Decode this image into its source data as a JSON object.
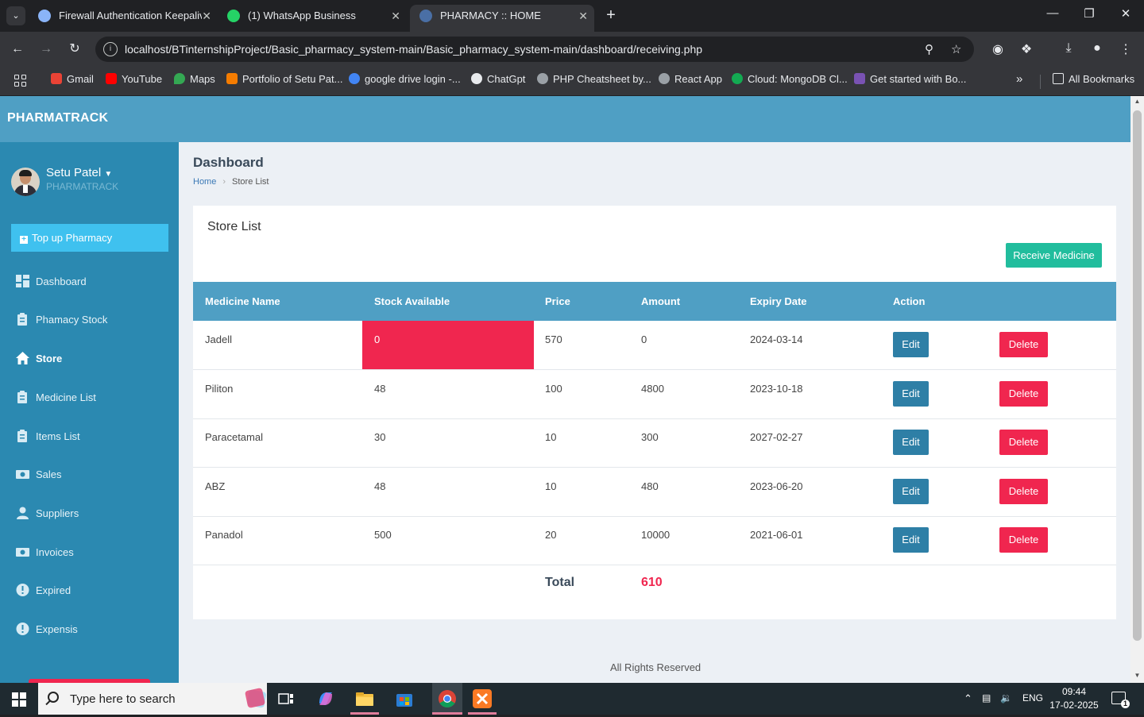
{
  "browser": {
    "tabs": [
      {
        "title": "Firewall Authentication Keepaliv",
        "favicon_color": "#8ab4f8",
        "active": false
      },
      {
        "title": "(1) WhatsApp Business",
        "favicon_color": "#25d366",
        "active": false
      },
      {
        "title": "PHARMACY :: HOME",
        "favicon_color": "#4a6fa5",
        "active": true
      }
    ],
    "url": "localhost/BTinternshipProject/Basic_pharmacy_system-main/Basic_pharmacy_system-main/dashboard/receiving.php",
    "bookmarks": [
      {
        "label": "Gmail",
        "color": "#ea4335"
      },
      {
        "label": "YouTube",
        "color": "#ff0000"
      },
      {
        "label": "Maps",
        "color": "#34a853"
      },
      {
        "label": "Portfolio of Setu Pat...",
        "color": "#f57c00"
      },
      {
        "label": "google drive login -...",
        "color": "#4285f4"
      },
      {
        "label": "ChatGpt",
        "color": "#e8eaed"
      },
      {
        "label": "PHP Cheatsheet by...",
        "color": "#9aa0a6"
      },
      {
        "label": "React App",
        "color": "#9aa0a6"
      },
      {
        "label": "Cloud: MongoDB Cl...",
        "color": "#13aa52"
      },
      {
        "label": "Get started with Bo...",
        "color": "#7952b3"
      }
    ],
    "all_bookmarks": "All Bookmarks"
  },
  "app": {
    "brand": "PHARMATRACK",
    "user": {
      "name": "Setu Patel",
      "role": "PHARMATRACK"
    },
    "topup_label": "Top up Pharmacy",
    "nav": [
      {
        "label": "Dashboard",
        "icon": "dashboard-icon",
        "active": false
      },
      {
        "label": "Phamacy Stock",
        "icon": "clipboard-icon",
        "active": false
      },
      {
        "label": "Store",
        "icon": "home-icon",
        "active": true
      },
      {
        "label": "Medicine List",
        "icon": "clipboard-icon",
        "active": false
      },
      {
        "label": "Items List",
        "icon": "clipboard-icon",
        "active": false
      },
      {
        "label": "Sales",
        "icon": "money-icon",
        "active": false
      },
      {
        "label": "Suppliers",
        "icon": "user-icon",
        "active": false
      },
      {
        "label": "Invoices",
        "icon": "money-icon",
        "active": false
      },
      {
        "label": "Expired",
        "icon": "badge-icon",
        "active": false
      },
      {
        "label": "Expensis",
        "icon": "badge-icon",
        "active": false
      }
    ],
    "header": {
      "title": "Dashboard",
      "breadcrumb_home": "Home",
      "breadcrumb_current": "Store List"
    },
    "card": {
      "title": "Store List",
      "receive_button": "Receive Medicine",
      "columns": [
        "Medicine Name",
        "Stock Available",
        "Price",
        "Amount",
        "Expiry Date",
        "Action"
      ],
      "rows": [
        {
          "name": "Jadell",
          "stock": "0",
          "price": "570",
          "amount": "0",
          "expiry": "2024-03-14",
          "low_stock": true
        },
        {
          "name": "Piliton",
          "stock": "48",
          "price": "100",
          "amount": "4800",
          "expiry": "2023-10-18",
          "low_stock": false
        },
        {
          "name": "Paracetamal",
          "stock": "30",
          "price": "10",
          "amount": "300",
          "expiry": "2027-02-27",
          "low_stock": false
        },
        {
          "name": "ABZ",
          "stock": "48",
          "price": "10",
          "amount": "480",
          "expiry": "2023-06-20",
          "low_stock": false
        },
        {
          "name": "Panadol",
          "stock": "500",
          "price": "20",
          "amount": "10000",
          "expiry": "2021-06-01",
          "low_stock": false
        }
      ],
      "edit_label": "Edit",
      "delete_label": "Delete",
      "total_label": "Total",
      "total_value": "610"
    },
    "footer": "All Rights Reserved"
  },
  "taskbar": {
    "search_placeholder": "Type here to search",
    "language": "ENG",
    "time": "09:44",
    "date": "17-02-2025",
    "notifications": "1"
  },
  "colors": {
    "header_blue": "#4f9fc4",
    "sidebar_blue": "#2b89b1",
    "danger": "#f0264f",
    "success": "#21bd9d",
    "edit": "#2e7fa6"
  }
}
